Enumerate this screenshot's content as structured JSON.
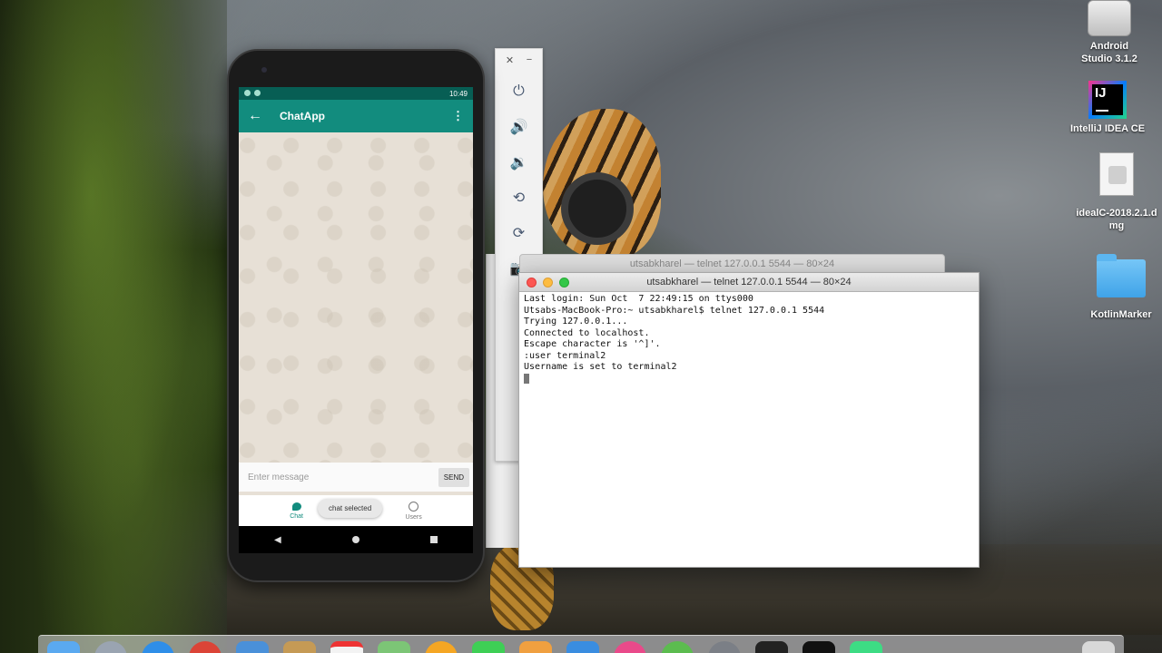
{
  "desktop": {
    "icons": [
      {
        "label": "Android Studio 3.1.2"
      },
      {
        "label": "IntelliJ IDEA CE"
      },
      {
        "label": "idealC-2018.2.1.dmg"
      },
      {
        "label": "KotlinMarker"
      }
    ],
    "ij_badge": "IJ"
  },
  "phone": {
    "status": {
      "time": "10:49"
    },
    "appbar": {
      "back": "←",
      "title": "ChatApp",
      "menu": "⋮"
    },
    "input": {
      "placeholder": "Enter message",
      "send": "SEND"
    },
    "nav": {
      "chat": "Chat",
      "users": "Users"
    },
    "toast": "chat selected",
    "sysnav": {
      "back": "◀"
    }
  },
  "emulator": {
    "close": "✕",
    "minimize": "−",
    "tools": [
      "power",
      "volume-up",
      "volume-down",
      "rotate-left",
      "rotate-right",
      "camera"
    ],
    "tool_glyphs": [
      "⏻",
      "🔊",
      "🔉",
      "⟲",
      "⟳",
      "📷"
    ]
  },
  "terminal_back": {
    "title": "utsabkharel — telnet 127.0.0.1 5544 — 80×24"
  },
  "terminal": {
    "title": "utsabkharel — telnet 127.0.0.1 5544 — 80×24",
    "lines": [
      "Last login: Sun Oct  7 22:49:15 on ttys000",
      "Utsabs-MacBook-Pro:~ utsabkharel$ telnet 127.0.0.1 5544",
      "Trying 127.0.0.1...",
      "Connected to localhost.",
      "Escape character is '^]'.",
      ":user terminal2",
      "Username is set to terminal2"
    ]
  },
  "dock": {
    "apps": [
      "finder",
      "launchpad",
      "safari",
      "chrome",
      "mail",
      "notes",
      "calendar",
      "maps",
      "photos",
      "messages",
      "facetime",
      "app-store",
      "itunes",
      "ibooks",
      "system-preferences",
      "terminal",
      "intellij",
      "android-studio",
      "trash"
    ]
  }
}
